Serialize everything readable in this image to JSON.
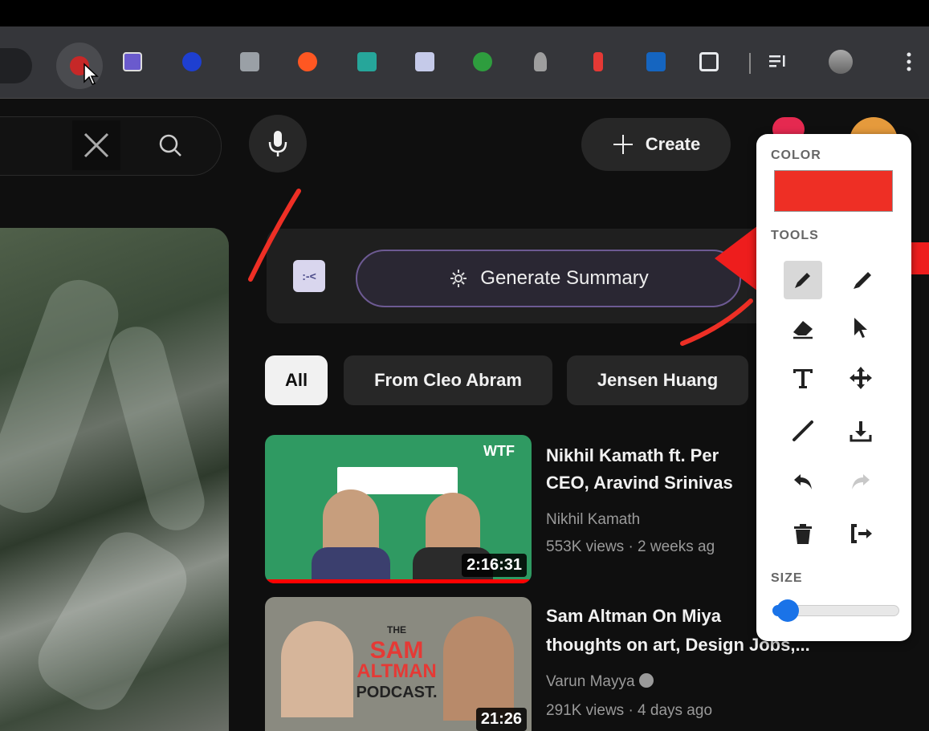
{
  "browser": {
    "extensions": [
      {
        "name": "red-extension",
        "color": "#c62828"
      },
      {
        "name": "purple-extension",
        "color": "#6a5acd"
      },
      {
        "name": "info-extension",
        "color": "#1e3fd0"
      },
      {
        "name": "grid-extension",
        "color": "#9aa0a6"
      },
      {
        "name": "orange-plus-extension",
        "color": "#ff5722"
      },
      {
        "name": "teal-extension",
        "color": "#26a69a"
      },
      {
        "name": "summary-extension",
        "color": "#c5cae9"
      },
      {
        "name": "green-extension",
        "color": "#2e9d3e"
      },
      {
        "name": "grey-extension",
        "color": "#9e9e9e"
      },
      {
        "name": "speaker-extension",
        "color": "#e53935"
      },
      {
        "name": "n-extension",
        "color": "#1565c0"
      },
      {
        "name": "puzzle-extension",
        "color": "#e8eaed"
      }
    ]
  },
  "header": {
    "create_label": "Create"
  },
  "summary": {
    "logo_text": ":-<",
    "button_label": "Generate Summary"
  },
  "chips": [
    "All",
    "From Cleo Abram",
    "Jensen Huang"
  ],
  "videos": [
    {
      "title_line1": "Nikhil Kamath ft. Per",
      "title_line2": "CEO, Aravind Srinivas",
      "channel": "Nikhil Kamath",
      "stats": "553K views · 2 weeks ag",
      "duration": "2:16:31",
      "badge": "WTF"
    },
    {
      "title_line1": "Sam Altman On Miya",
      "title_line2": "thoughts on art, Design Jobs,...",
      "channel": "Varun Mayya",
      "stats": "291K views · 4 days ago",
      "duration": "21:26",
      "thumb_text1": "THE",
      "thumb_text2": "SAM",
      "thumb_text3": "ALTMAN",
      "thumb_text4": "PODCAST."
    }
  ],
  "annotation": {
    "color_label": "COLOR",
    "tools_label": "TOOLS",
    "size_label": "SIZE",
    "selected_color": "#ee2f25",
    "size_fraction": 0.08
  }
}
